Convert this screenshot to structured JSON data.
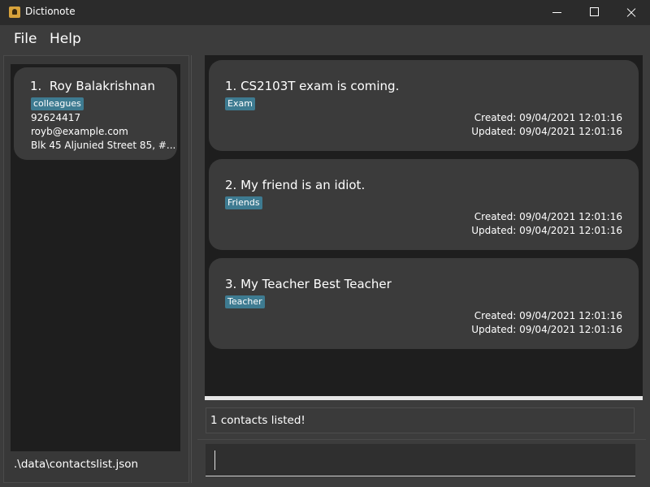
{
  "window": {
    "title": "Dictionote"
  },
  "menu": {
    "file": "File",
    "help": "Help"
  },
  "contacts": [
    {
      "index": "1.",
      "name": "Roy Balakrishnan",
      "tag": "colleagues",
      "phone": "92624417",
      "email": "royb@example.com",
      "address": "Blk 45 Aljunied Street 85, #..."
    }
  ],
  "notes": [
    {
      "title": "1.  CS2103T exam is coming.",
      "tag": "Exam",
      "created": "Created: 09/04/2021 12:01:16",
      "updated": "Updated: 09/04/2021 12:01:16"
    },
    {
      "title": "2.  My friend is an idiot.",
      "tag": "Friends",
      "created": "Created: 09/04/2021 12:01:16",
      "updated": "Updated: 09/04/2021 12:01:16"
    },
    {
      "title": "3.  My Teacher Best Teacher",
      "tag": "Teacher",
      "created": "Created: 09/04/2021 12:01:16",
      "updated": "Updated: 09/04/2021 12:01:16"
    }
  ],
  "result_display": "1 contacts listed!",
  "status_bar": {
    "file_path": ".\\data\\contactslist.json"
  },
  "command_box": {
    "value": ""
  },
  "colors": {
    "tag": "#3e7b91",
    "card": "#3b3b3b",
    "list_bg": "#1e1e1e",
    "background": "#3c3c3c"
  }
}
